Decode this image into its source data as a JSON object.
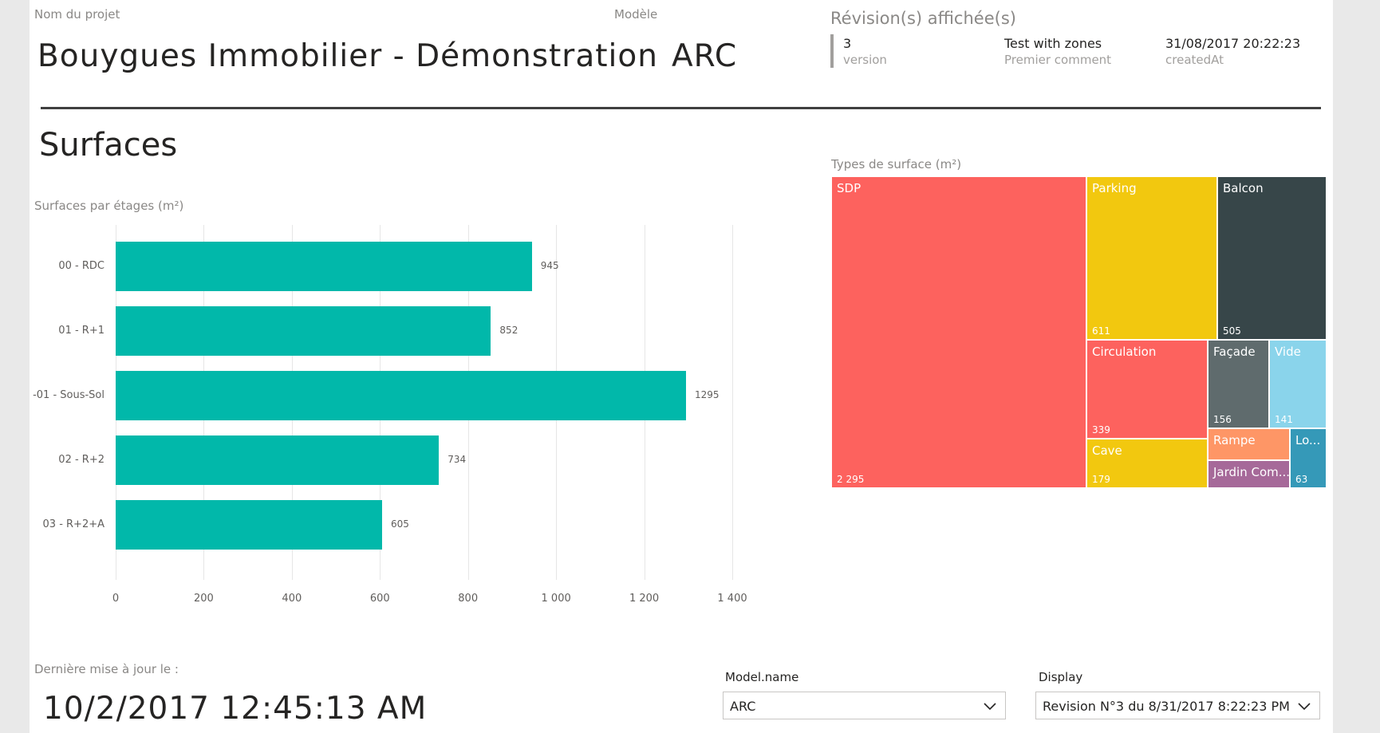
{
  "header": {
    "project_label": "Nom du projet",
    "project_name": "Bouygues Immobilier - Démonstration",
    "model_label": "Modèle",
    "model_name": "ARC",
    "revision_title": "Révision(s) affichée(s)",
    "revision": {
      "version_value": "3",
      "version_label": "version",
      "comment_value": "Test with zones",
      "comment_label": "Premier comment",
      "created_value": "31/08/2017 20:22:23",
      "created_label": "createdAt"
    }
  },
  "section_title": "Surfaces",
  "bar_chart_title": "Surfaces par étages (m²)",
  "treemap_title": "Types de surface (m²)",
  "chart_data": [
    {
      "type": "bar",
      "orientation": "horizontal",
      "title": "Surfaces par étages (m²)",
      "categories": [
        "00 - RDC",
        "01 - R+1",
        "-01 - Sous-Sol",
        "02 - R+2",
        "03 - R+2+A"
      ],
      "values": [
        945,
        852,
        1295,
        734,
        605
      ],
      "value_labels": [
        "945",
        "852",
        "1295",
        "734",
        "605"
      ],
      "xlim": [
        0,
        1400
      ],
      "ticks": [
        0,
        200,
        400,
        600,
        800,
        1000,
        1200,
        1400
      ],
      "tick_labels": [
        "0",
        "200",
        "400",
        "600",
        "800",
        "1 000",
        "1 200",
        "1 400"
      ],
      "color": "#01b8aa",
      "grid": true
    },
    {
      "type": "treemap",
      "title": "Types de surface (m²)",
      "items": [
        {
          "name": "SDP",
          "value": 2295,
          "label": "2 295",
          "color": "#fd625e"
        },
        {
          "name": "Parking",
          "value": 611,
          "label": "611",
          "color": "#f2c80f"
        },
        {
          "name": "Balcon",
          "value": 505,
          "label": "505",
          "color": "#374649"
        },
        {
          "name": "Circulation",
          "value": 339,
          "label": "339",
          "color": "#fd625e"
        },
        {
          "name": "Cave",
          "value": 179,
          "label": "179",
          "color": "#f2c80f"
        },
        {
          "name": "Façade",
          "value": 156,
          "label": "156",
          "color": "#5f6b6d"
        },
        {
          "name": "Vide",
          "value": 141,
          "label": "141",
          "color": "#8ad4eb"
        },
        {
          "name": "Rampe",
          "value": null,
          "label": "",
          "color": "#fe9666"
        },
        {
          "name": "Jardin Com...",
          "value": null,
          "label": "",
          "color": "#a66999"
        },
        {
          "name": "Lo...",
          "value": 63,
          "label": "63",
          "color": "#3599b8"
        }
      ]
    }
  ],
  "footer": {
    "updated_label": "Dernière mise à jour le :",
    "updated_value": "10/2/2017 12:45:13 AM",
    "model_slicer_label": "Model.name",
    "model_slicer_value": "ARC",
    "display_slicer_label": "Display",
    "display_slicer_value": "Revision N°3 du 8/31/2017 8:22:23 PM"
  }
}
